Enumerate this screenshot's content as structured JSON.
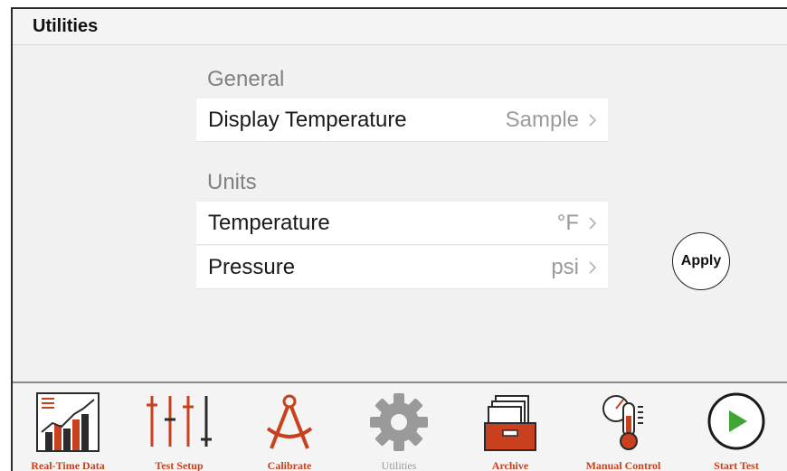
{
  "header": {
    "title": "Utilities"
  },
  "sections": [
    {
      "heading": "General",
      "rows": [
        {
          "label": "Display Temperature",
          "value": "Sample"
        }
      ]
    },
    {
      "heading": "Units",
      "rows": [
        {
          "label": "Temperature",
          "value": "°F"
        },
        {
          "label": "Pressure",
          "value": "psi"
        }
      ]
    }
  ],
  "apply_label": "Apply",
  "tabs": [
    {
      "label": "Real-Time Data",
      "icon": "chart-icon"
    },
    {
      "label": "Test Setup",
      "icon": "sliders-icon"
    },
    {
      "label": "Calibrate",
      "icon": "compass-icon"
    },
    {
      "label": "Utilities",
      "icon": "gear-icon",
      "active": true
    },
    {
      "label": "Archive",
      "icon": "file-box-icon"
    },
    {
      "label": "Manual Control",
      "icon": "thermometer-gauge-icon"
    },
    {
      "label": "Start Test",
      "icon": "play-icon"
    }
  ],
  "colors": {
    "accent": "#c8401c",
    "dark": "#2b2b2b",
    "play": "#3fa535",
    "muted": "#9a9a9a"
  }
}
